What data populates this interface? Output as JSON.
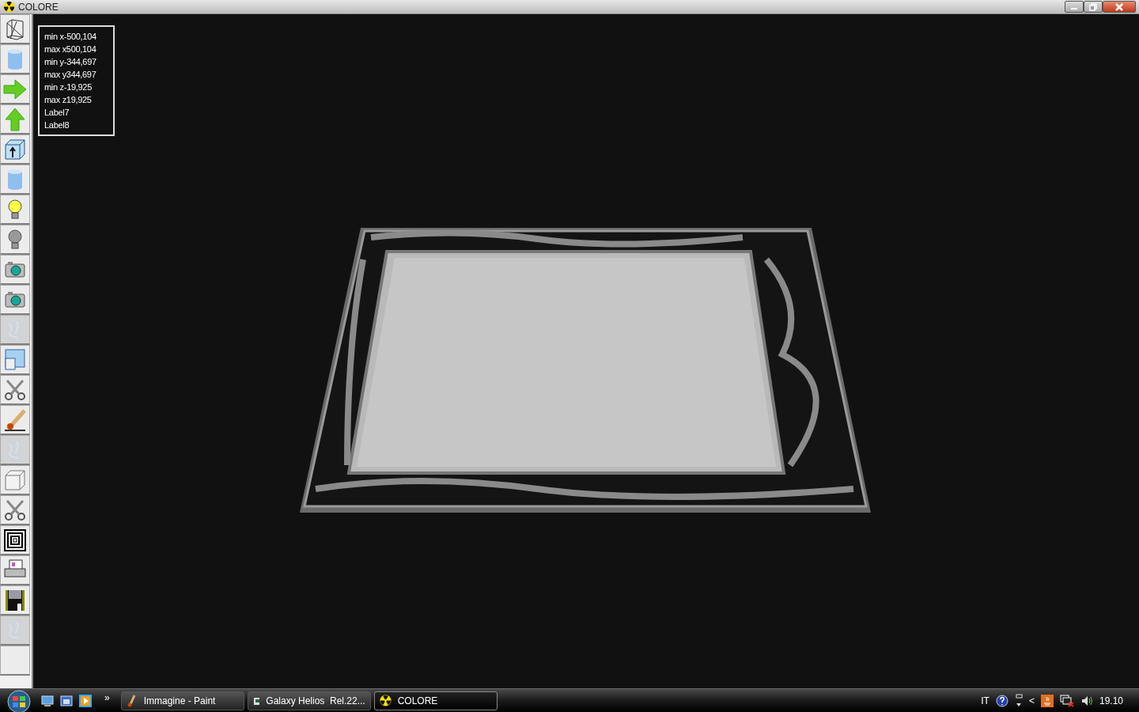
{
  "window": {
    "title": "COLORE"
  },
  "info_panel": {
    "lines": [
      "min x-500,104",
      "max x500,104",
      "min y-344,697",
      "max y344,697",
      "min z-19,925",
      "max z19,925",
      "Label7",
      "Label8"
    ]
  },
  "toolbar": {
    "tools": [
      {
        "disabled": false
      },
      {
        "disabled": false
      },
      {
        "disabled": false
      },
      {
        "disabled": false
      },
      {
        "disabled": false
      },
      {
        "disabled": false
      },
      {
        "disabled": false
      },
      {
        "disabled": false
      },
      {
        "disabled": false
      },
      {
        "disabled": false
      },
      {
        "disabled": true
      },
      {
        "disabled": false
      },
      {
        "disabled": false
      },
      {
        "disabled": false
      },
      {
        "disabled": true
      },
      {
        "disabled": false
      },
      {
        "disabled": false
      },
      {
        "disabled": false
      },
      {
        "disabled": false
      },
      {
        "disabled": false
      },
      {
        "disabled": true
      },
      {
        "disabled": false
      }
    ]
  },
  "taskbar": {
    "more": "»",
    "tasks": [
      {
        "label": "Immagine - Paint",
        "selected": false
      },
      {
        "label": "Galaxy Helios  Rel.22...",
        "selected": false
      },
      {
        "label": "COLORE",
        "selected": true
      }
    ],
    "tray": {
      "language": "IT",
      "chevron": "<",
      "clock": "19.10"
    }
  }
}
